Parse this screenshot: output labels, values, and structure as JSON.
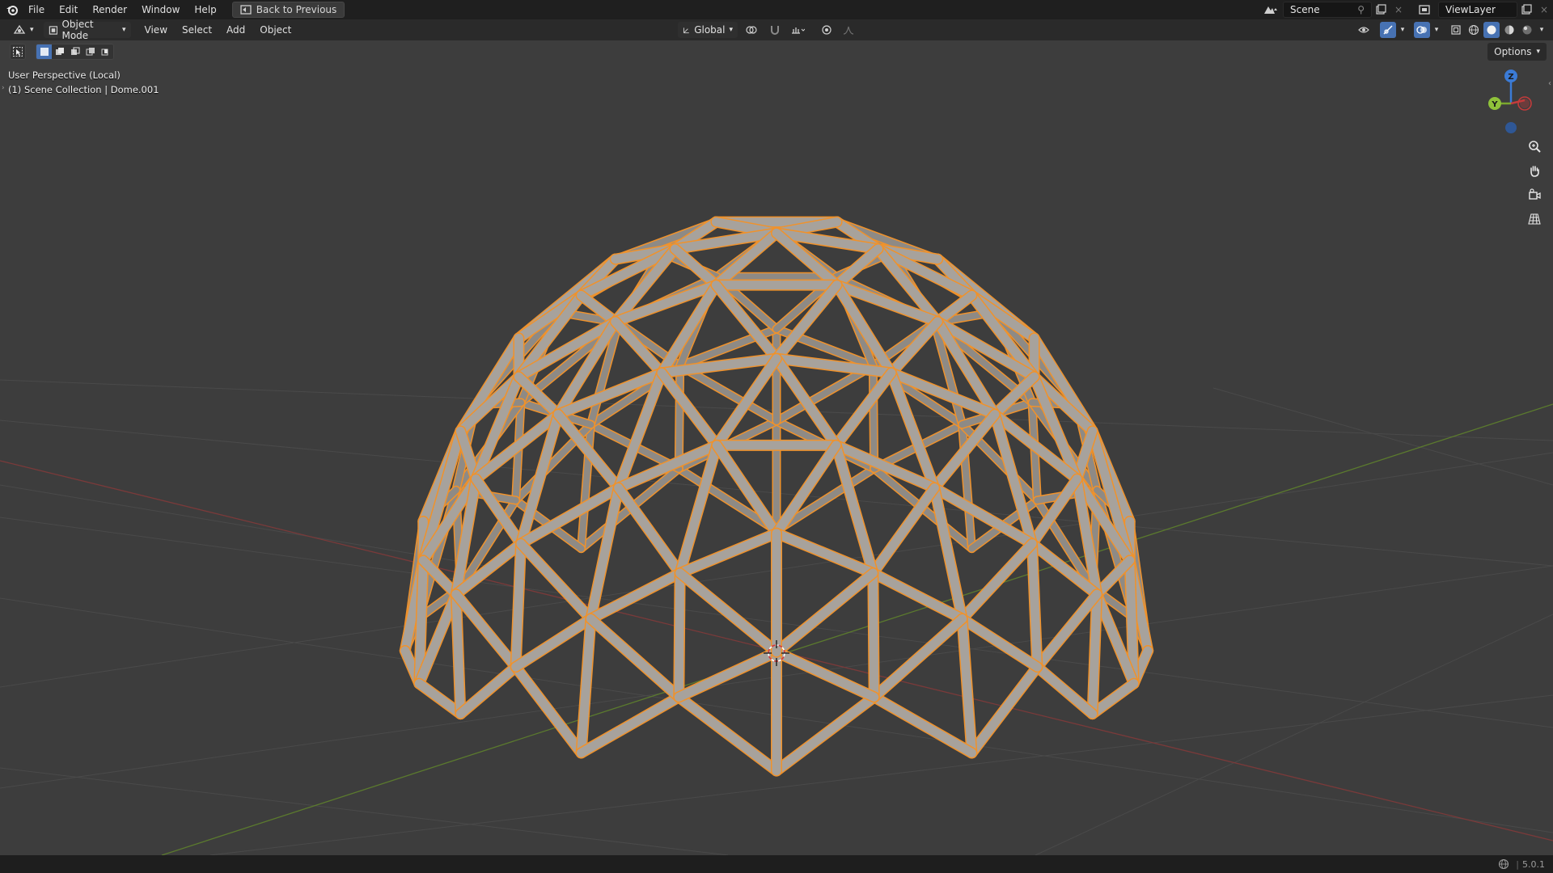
{
  "menubar": {
    "items": [
      "File",
      "Edit",
      "Render",
      "Window",
      "Help"
    ],
    "back_label": "Back to Previous"
  },
  "topright": {
    "scene_name": "Scene",
    "view_layer": "ViewLayer"
  },
  "header": {
    "mode": "Object Mode",
    "menus": [
      "View",
      "Select",
      "Add",
      "Object"
    ],
    "orientation": "Global"
  },
  "toolrow": {
    "options_label": "Options"
  },
  "viewport": {
    "perspective_label": "User Perspective (Local)",
    "collection_label": "(1) Scene Collection | Dome.001"
  },
  "gizmo": {
    "x_label": "X",
    "y_label": "Y",
    "z_label": "Z"
  },
  "status": {
    "version": "5.0.1"
  },
  "colors": {
    "selection_outline": "#f0922b",
    "strut_fill": "#a7a29c",
    "background": "#3d3d3d",
    "accent": "#4772b3"
  }
}
